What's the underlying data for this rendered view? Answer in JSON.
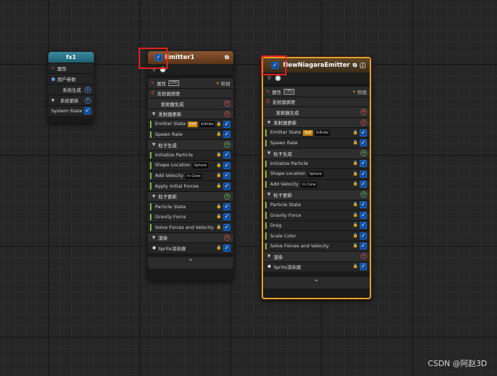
{
  "system": {
    "title": "fx1",
    "rows": [
      "属性",
      "用户参数",
      "系统生成",
      "系统更新",
      "System State"
    ]
  },
  "emitter1": {
    "title": "Emitter1",
    "props_label": "属性",
    "stage_label": "阶段",
    "summary": "发射器摘要",
    "spawn_group": "发射器生成",
    "update_group": "发射器更新",
    "emitter_state": "Emitter State",
    "self_pill": "Self",
    "infinite_pill": "Infinite",
    "spawn_rate": "Spawn Rate",
    "particle_spawn": "粒子生成",
    "init_particle": "Initialize Particle",
    "shape_location": "Shape Location",
    "sphere_pill": "Sphere",
    "add_velocity": "Add Velocity",
    "incone_pill": "In Cone",
    "apply_forces": "Apply Initial Forces",
    "particle_update": "粒子更新",
    "particle_state": "Particle State",
    "gravity": "Gravity Force",
    "solve": "Solve Forces and Velocity",
    "render": "渲染",
    "sprite": "Sprite渲染器"
  },
  "emitter2": {
    "title": "NewNiagaraEmitter",
    "props_label": "属性",
    "stage_label": "阶段",
    "summary": "发射器摘要",
    "spawn_group": "发射器生成",
    "update_group": "发射器更新",
    "emitter_state": "Emitter State",
    "self_pill": "Self",
    "infinite_pill": "Infinite",
    "spawn_rate": "Spawn Rate",
    "particle_spawn": "粒子生成",
    "init_particle": "Initialize Particle",
    "shape_location": "Shape Location",
    "sphere_pill": "Sphere",
    "add_velocity": "Add Velocity",
    "incone_pill": "In Cone",
    "particle_update": "粒子更新",
    "particle_state": "Particle State",
    "gravity": "Gravity Force",
    "drag": "Drag",
    "scale_color": "Scale Color",
    "solve": "Solve Forces and Velocity",
    "render": "渲染",
    "sprite": "Sprite渲染器"
  },
  "watermark": "CSDN @阿赵3D",
  "icons": [
    "check-icon",
    "lock-icon",
    "plus-circle-icon",
    "chevron-up-icon",
    "external-link-icon",
    "info-icon",
    "pencil-icon",
    "list-icon",
    "user-icon",
    "gpu-icon",
    "sprite-icon"
  ],
  "colors": {
    "emitter1_header": "#7a4a2a",
    "emitter2_header": "#5a4428",
    "selected_border": "#f0a020",
    "highlight_box": "#e32020",
    "system_header": "#2f7a90"
  }
}
